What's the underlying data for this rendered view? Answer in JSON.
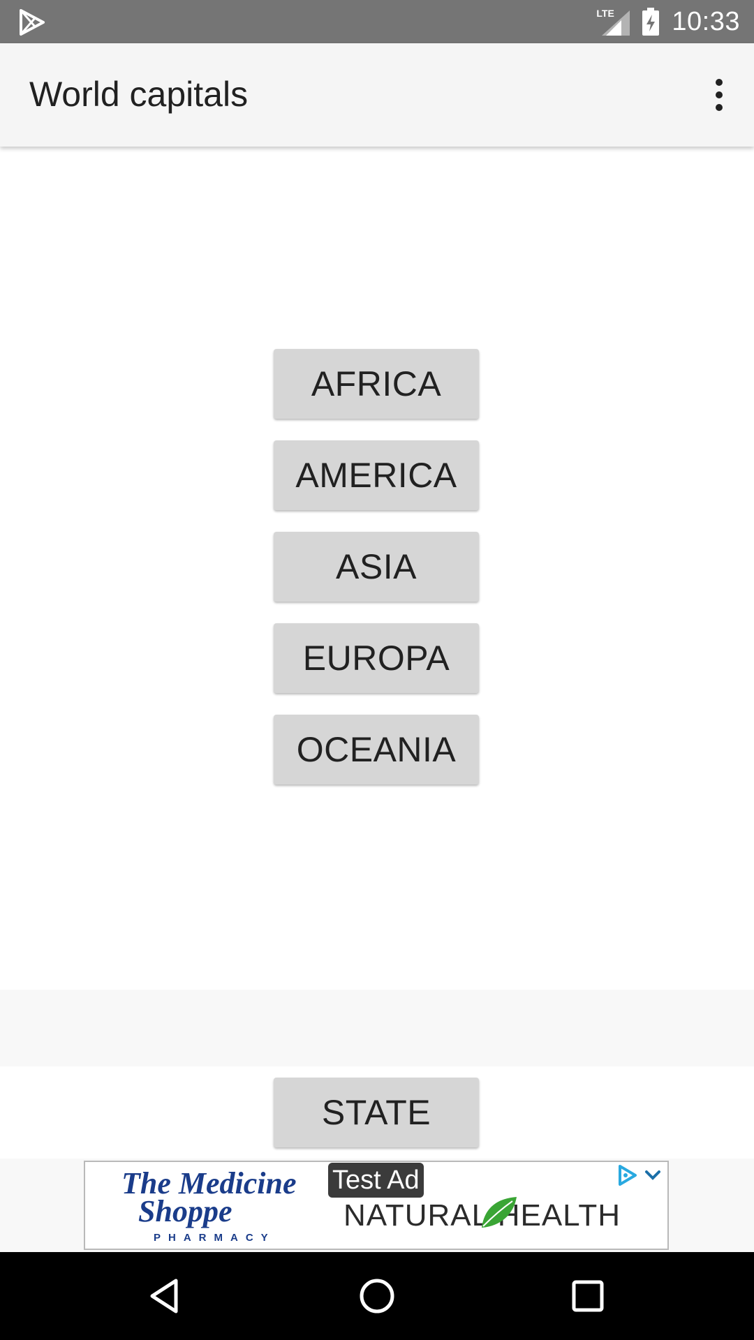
{
  "status_bar": {
    "network_label": "LTE",
    "time": "10:33",
    "icons": [
      "play-store-icon",
      "signal-icon",
      "battery-charging-icon"
    ]
  },
  "app_bar": {
    "title": "World capitals",
    "overflow_icon": "more-vert-icon"
  },
  "continents": [
    "AFRICA",
    "AMERICA",
    "ASIA",
    "EUROPA",
    "OCEANIA"
  ],
  "state_button": "STATE",
  "ad": {
    "label": "Test Ad",
    "brand_line1": "The Medicine",
    "brand_line2": "Shoppe",
    "brand_line3": "PHARMACY",
    "headline": "NATURAL HEALTH",
    "icons": [
      "ad-choices-icon",
      "collapse-chevron-icon",
      "leaf-icon"
    ]
  },
  "nav_bar": {
    "icons": [
      "back-icon",
      "home-icon",
      "recents-icon"
    ]
  },
  "colors": {
    "status_bar": "#757575",
    "app_bar": "#f5f5f5",
    "button": "#d6d6d6",
    "brand_blue": "#1a3c8a",
    "leaf_green": "#3aa535"
  }
}
